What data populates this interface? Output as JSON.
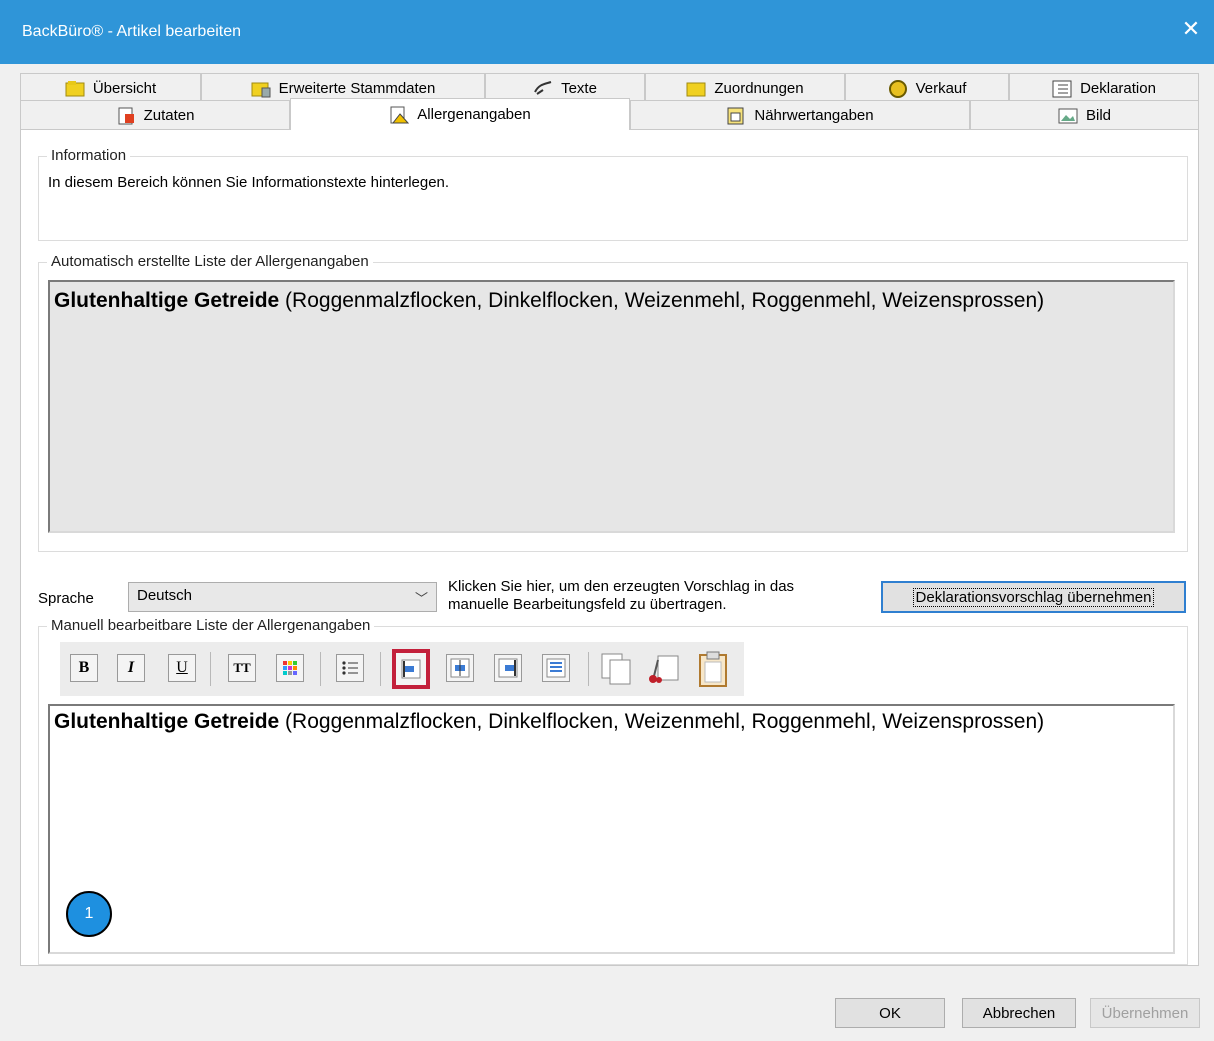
{
  "window": {
    "title": "BackBüro® - Artikel bearbeiten",
    "close_glyph": "✕"
  },
  "tabs_row1": [
    {
      "label": "Übersicht",
      "icon": "folder-icon"
    },
    {
      "label": "Erweiterte Stammdaten",
      "icon": "extended-data-icon"
    },
    {
      "label": "Texte",
      "icon": "pen-icon"
    },
    {
      "label": "Zuordnungen",
      "icon": "folder-icon"
    },
    {
      "label": "Verkauf",
      "icon": "coin-icon"
    },
    {
      "label": "Deklaration",
      "icon": "list-icon"
    }
  ],
  "tabs_row2": [
    {
      "label": "Zutaten",
      "icon": "document-icon"
    },
    {
      "label": "Allergenangaben",
      "icon": "warning-document-icon",
      "active": true
    },
    {
      "label": "Nährwertangaben",
      "icon": "nutrition-icon"
    },
    {
      "label": "Bild",
      "icon": "image-icon"
    }
  ],
  "information": {
    "legend": "Information",
    "text": "In diesem Bereich können Sie Informationstexte hinterlegen."
  },
  "auto_list": {
    "legend": "Automatisch erstellte Liste der Allergenangaben",
    "bold": "Glutenhaltige Getreide",
    "rest": " (Roggenmalzflocken, Dinkelflocken, Weizenmehl, Roggenmehl, Weizensprossen)"
  },
  "language": {
    "label": "Sprache",
    "value": "Deutsch",
    "hint_line1": "Klicken Sie hier, um den erzeugten Vorschlag in das",
    "hint_line2": "manuelle Bearbeitungsfeld zu übertragen.",
    "apply_button": "Deklarationsvorschlag übernehmen"
  },
  "manual_list": {
    "legend": "Manuell bearbeitbare Liste der Allergenangaben",
    "bold": "Glutenhaltige Getreide",
    "rest": " (Roggenmalzflocken, Dinkelflocken, Weizenmehl, Roggenmehl, Weizensprossen)"
  },
  "toolbar": {
    "bold": "B",
    "italic": "I",
    "underline": "U",
    "font_size": "TT"
  },
  "marker": "1",
  "buttons": {
    "ok": "OK",
    "cancel": "Abbrechen",
    "apply": "Übernehmen"
  },
  "colors": {
    "titlebar": "#2f95d8",
    "highlight": "#c3203b",
    "marker": "#1e90e0"
  }
}
